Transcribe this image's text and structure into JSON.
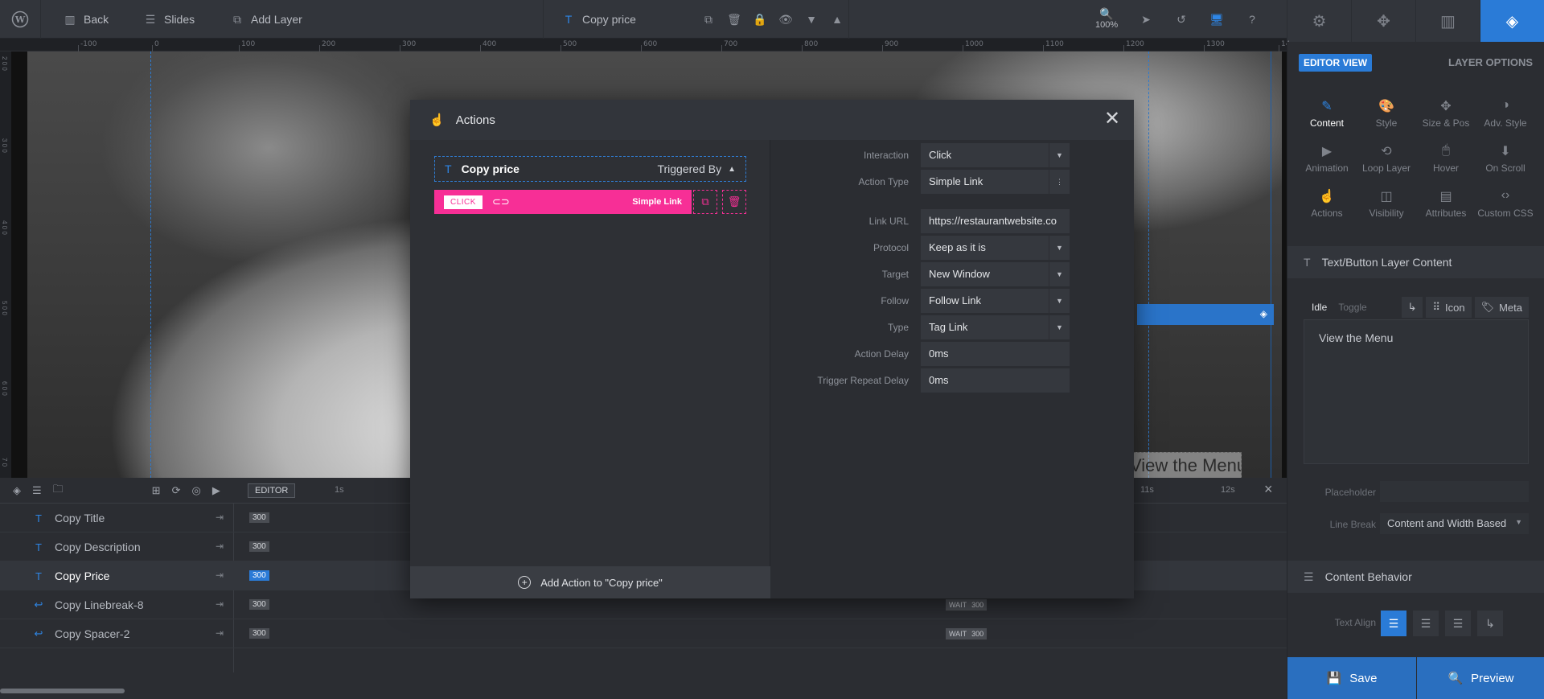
{
  "topbar": {
    "back_label": "Back",
    "slides_label": "Slides",
    "add_layer_label": "Add Layer",
    "layer_title": "Copy price",
    "zoom": "100%"
  },
  "ruler": {
    "ticks": [
      "-100",
      "0",
      "100",
      "200",
      "300",
      "400",
      "500",
      "600",
      "700",
      "800",
      "900",
      "1000",
      "1100",
      "1200",
      "1300",
      "14"
    ]
  },
  "canvas": {
    "menu_text": "View the Menu"
  },
  "timeline": {
    "editor_tag": "EDITOR",
    "time_marks": [
      "1s",
      "11s",
      "12s"
    ],
    "rows": [
      {
        "icon": "T",
        "label": "Copy Title",
        "duration": "300"
      },
      {
        "icon": "T",
        "label": "Copy Description",
        "duration": "300"
      },
      {
        "icon": "T",
        "label": "Copy Price",
        "duration": "300"
      },
      {
        "icon": "↩",
        "label": "Copy Linebreak-8",
        "duration": "300",
        "wait": "WAIT",
        "wait_value": "300"
      },
      {
        "icon": "↩",
        "label": "Copy Spacer-2",
        "duration": "300",
        "wait": "WAIT",
        "wait_value": "300"
      }
    ]
  },
  "sidebar": {
    "editor_view": "EDITOR VIEW",
    "layer_options": "LAYER OPTIONS",
    "options": [
      {
        "label": "Content",
        "icon": "✎"
      },
      {
        "label": "Style",
        "icon": "🎨"
      },
      {
        "label": "Size & Pos",
        "icon": "✥"
      },
      {
        "label": "Adv. Style",
        "icon": "◑"
      },
      {
        "label": "Animation",
        "icon": "▶"
      },
      {
        "label": "Loop Layer",
        "icon": "⟲"
      },
      {
        "label": "Hover",
        "icon": "🖱"
      },
      {
        "label": "On Scroll",
        "icon": "⬇"
      },
      {
        "label": "Actions",
        "icon": "☝"
      },
      {
        "label": "Visibility",
        "icon": "◫"
      },
      {
        "label": "Attributes",
        "icon": "▤"
      },
      {
        "label": "Custom CSS",
        "icon": "‹›"
      }
    ],
    "section_content": "Text/Button Layer Content",
    "idle_label": "Idle",
    "toggle_label": "Toggle",
    "icon_label": "Icon",
    "meta_label": "Meta",
    "content_text": "View the Menu",
    "placeholder_label": "Placeholder",
    "placeholder_value": "",
    "linebreak_label": "Line Break",
    "linebreak_value": "Content and Width Based",
    "section_behavior": "Content Behavior",
    "text_align_label": "Text Align",
    "save_label": "Save",
    "preview_label": "Preview"
  },
  "modal": {
    "title": "Actions",
    "trigger_layer": "Copy price",
    "triggered_by": "Triggered By",
    "action_tag": "CLICK",
    "action_name": "Simple Link",
    "add_action": "Add Action to \"Copy price\"",
    "fields": [
      {
        "label": "Interaction",
        "value": "Click",
        "type": "select"
      },
      {
        "label": "Action Type",
        "value": "Simple Link",
        "type": "menu"
      },
      {
        "label": "Link URL",
        "value": "https://restaurantwebsite.co",
        "type": "input"
      },
      {
        "label": "Protocol",
        "value": "Keep as it is",
        "type": "select"
      },
      {
        "label": "Target",
        "value": "New Window",
        "type": "select"
      },
      {
        "label": "Follow",
        "value": "Follow Link",
        "type": "select"
      },
      {
        "label": "Type",
        "value": "Tag Link",
        "type": "select"
      },
      {
        "label": "Action Delay",
        "value": "0ms",
        "type": "input"
      },
      {
        "label": "Trigger Repeat Delay",
        "value": "0ms",
        "type": "input"
      }
    ]
  },
  "colors": {
    "accent_blue": "#2a7bd7",
    "action_pink": "#f72f96"
  }
}
